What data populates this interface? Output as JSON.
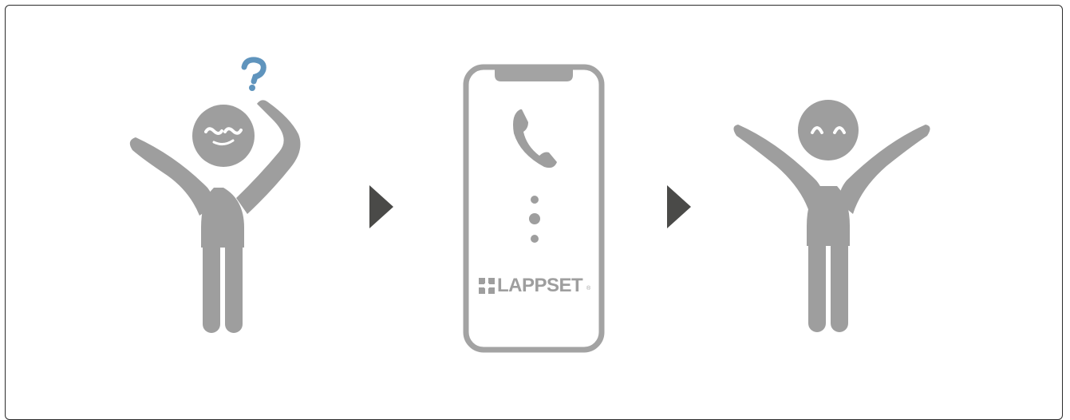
{
  "steps": [
    {
      "name": "confused-user",
      "expression": "confused"
    },
    {
      "name": "phone-call",
      "brand": "LAPPSET"
    },
    {
      "name": "happy-user",
      "expression": "happy"
    }
  ],
  "colors": {
    "figure": "#9e9e9e",
    "question": "#5f94bd",
    "arrow": "#4a4a48",
    "phone_outline": "#a3a3a3",
    "border": "#2b2b2b"
  },
  "icons": [
    "question-mark-icon",
    "arrow-right-icon",
    "phone-handset-icon",
    "ellipsis-vertical-icon",
    "lappset-logo-icon"
  ],
  "brand": {
    "name": "LAPPSET",
    "registered": "®"
  }
}
